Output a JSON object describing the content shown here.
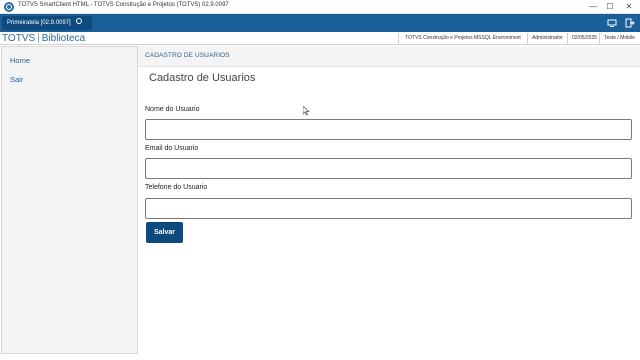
{
  "window": {
    "title": "TOTVS SmartClient HTML - TOTVS Construção e Projetos (TOTVS) 02.9.0097",
    "controls": {
      "minimize": "—",
      "maximize": "☐",
      "close": "✕"
    }
  },
  "tabbar": {
    "active_tab": "Primeiratela [02.9.0097]",
    "icons": [
      "display-icon",
      "exit-icon"
    ]
  },
  "header": {
    "brand": "TOTVS",
    "separator": "|",
    "module": "Biblioteca",
    "environment": "TOTVS Construção e Projetos MSSQL Environment",
    "user": "Administrador",
    "date": "02/05/2025",
    "mode": "Teste / Mobile"
  },
  "sidebar": {
    "items": [
      {
        "label": "Home"
      },
      {
        "label": "Sair"
      }
    ]
  },
  "main": {
    "breadcrumb": "CADASTRO DE USUARIOS",
    "title": "Cadastro de Usuarios",
    "fields": [
      {
        "label": "Nome do Usuario",
        "value": "",
        "placeholder": ""
      },
      {
        "label": "Email do Usuario",
        "value": "",
        "placeholder": ""
      },
      {
        "label": "Telefone do Usuario",
        "value": "",
        "placeholder": ""
      }
    ],
    "save_label": "Salvar"
  },
  "colors": {
    "tabbar": "#1b5f98",
    "active_tab": "#0e4a7d",
    "brand": "#2c6aa0",
    "button": "#0e4a7d",
    "sidebar_bg": "#f4f4f4"
  }
}
